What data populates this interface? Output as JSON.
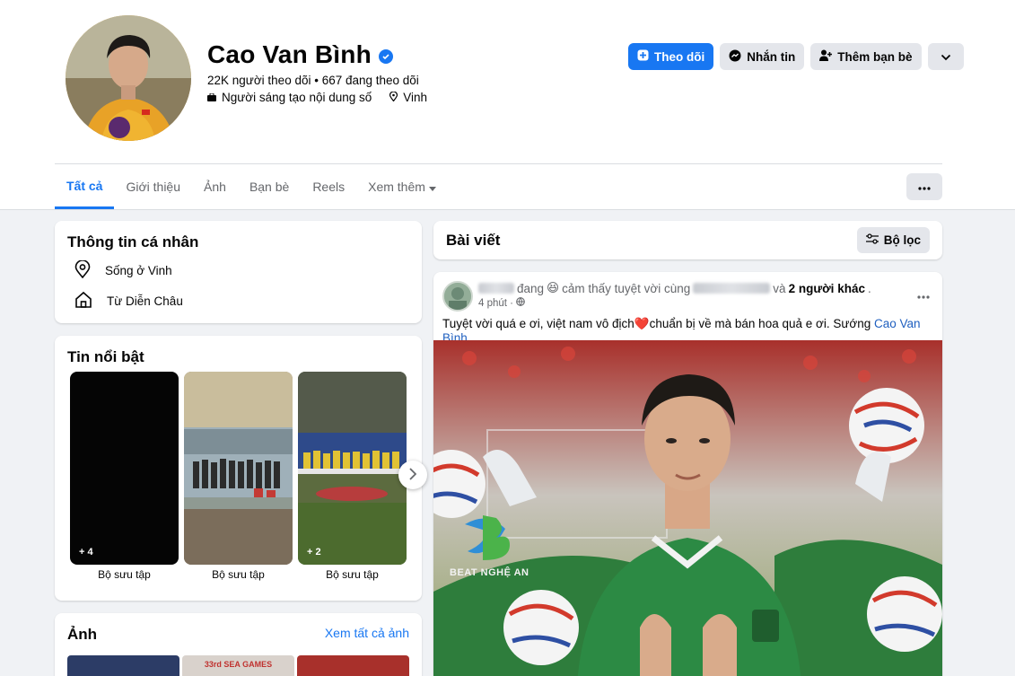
{
  "profile": {
    "name": "Cao Van Bình",
    "stats": "22K người theo dõi • 667 đang theo dõi",
    "category": "Người sáng tạo nội dung số",
    "location": "Vinh"
  },
  "actions": {
    "follow": "Theo dõi",
    "message": "Nhắn tin",
    "add_friend": "Thêm bạn bè"
  },
  "tabs": [
    {
      "label": "Tất cả"
    },
    {
      "label": "Giới thiệu"
    },
    {
      "label": "Ảnh"
    },
    {
      "label": "Bạn bè"
    },
    {
      "label": "Reels"
    },
    {
      "label": "Xem thêm"
    }
  ],
  "info": {
    "title": "Thông tin cá nhân",
    "lives_in": "Sống ở Vinh",
    "from": "Từ Diễn Châu"
  },
  "featured": {
    "title": "Tin nổi bật",
    "items": [
      {
        "label": "Bộ sưu tập",
        "count": "+ 4"
      },
      {
        "label": "Bộ sưu tập",
        "count": ""
      },
      {
        "label": "Bộ sưu tập",
        "count": "+ 2"
      }
    ]
  },
  "photos": {
    "title": "Ảnh",
    "see_all": "Xem tất cả ảnh",
    "thumb_text": "33rd SEA GAMES"
  },
  "posts": {
    "title": "Bài viết",
    "filter": "Bộ lọc"
  },
  "post": {
    "status_pre": "đang",
    "status_emoji": "😆",
    "status_mid": "cảm thấy tuyệt vời cùng",
    "status_and": "và",
    "others": "2 người khác",
    "dot": ".",
    "time": "4 phút ·",
    "text": "Tuyệt vời quá e ơi, việt nam vô địch❤️chuẩn bị về mà bán hoa quả e ơi. Sướng",
    "tag": "Cao Van Bình",
    "watermark": "BEAT NGHỆ AN"
  },
  "colors": {
    "accent": "#1877f2",
    "background": "#f0f2f5",
    "jersey_green": "#2e7d3c"
  }
}
